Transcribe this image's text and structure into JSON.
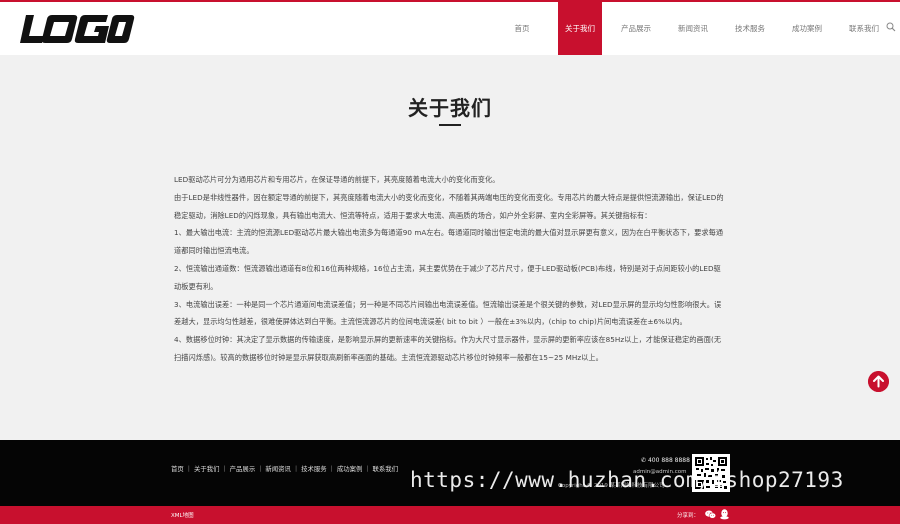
{
  "header": {
    "logo_text": "LOGO",
    "nav": [
      "首页",
      "关于我们",
      "产品展示",
      "新闻资讯",
      "技术服务",
      "成功案例",
      "联系我们"
    ],
    "active_index": 1
  },
  "section": {
    "title": "关于我们"
  },
  "content": {
    "paragraphs": [
      "LED驱动芯片可分为通用芯片和专用芯片，在保证导通的前提下，其亮度随着电流大小的变化而变化。",
      "由于LED是非线性器件，因在额定导通的前提下，其亮度随着电流大小的变化而变化，不随着其两端电压的变化而变化。专用芯片的最大特点是提供恒流源输出，保证LED的稳定驱动，消除LED的闪烁现象，具有输出电流大、恒流等特点，适用于要求大电流、高画质的场合，如户外全彩屏、室内全彩屏等。其关键指标有：",
      "1、最大输出电流：主流的恒流源LED驱动芯片最大输出电流多为每通道90 mA左右。每通道同时输出恒定电流的最大值对显示屏更有意义，因为在白平衡状态下，要求每通道都同时输出恒流电流。",
      "2、恒流输出通道数：恒流源输出通道有8位和16位两种规格，16位占主流，其主要优势在于减少了芯片尺寸，便于LED驱动板(PCB)布线，特别是对于点间距较小的LED驱动板更有利。",
      "3、电流输出误差：一种是同一个芯片通道间电流误差值；另一种是不同芯片间输出电流误差值。恒流输出误差是个很关键的参数，对LED显示屏的显示均匀性影响很大。误差越大，显示均匀性越差，很难使屏体达到白平衡。主流恒流源芯片的位间电流误差( bit to bit ）一般在±3%以内，(chip to chip)片间电流误差在±6%以内。",
      "4、数据移位时钟：其决定了显示数据的传输速度，是影响显示屏的更新速率的关键指标。作为大尺寸显示器件，显示屏的更新率应该在85Hz以上，才能保证稳定的画面(无扫描闪烁感)。较高的数据移位时钟是显示屏获取高刷新率画面的基础。主流恒流源驱动芯片移位时钟频率一般都在15~25 MHz以上。"
    ]
  },
  "footer": {
    "nav": [
      "首页",
      "关于我们",
      "产品展示",
      "新闻资讯",
      "技术服务",
      "成功案例",
      "联系我们"
    ],
    "phone": "400 888 8888",
    "email": "admin@admin.com",
    "address": "Copyright © 2019 某某网络科技有限公司"
  },
  "watermark": "https://www.huzhan.com/ishop27193",
  "bottom": {
    "xml": "XML地图",
    "share_label": "分享到："
  },
  "colors": {
    "accent": "#c8102e",
    "footer_bg": "#050505",
    "page_bg": "#f1f1f1"
  }
}
